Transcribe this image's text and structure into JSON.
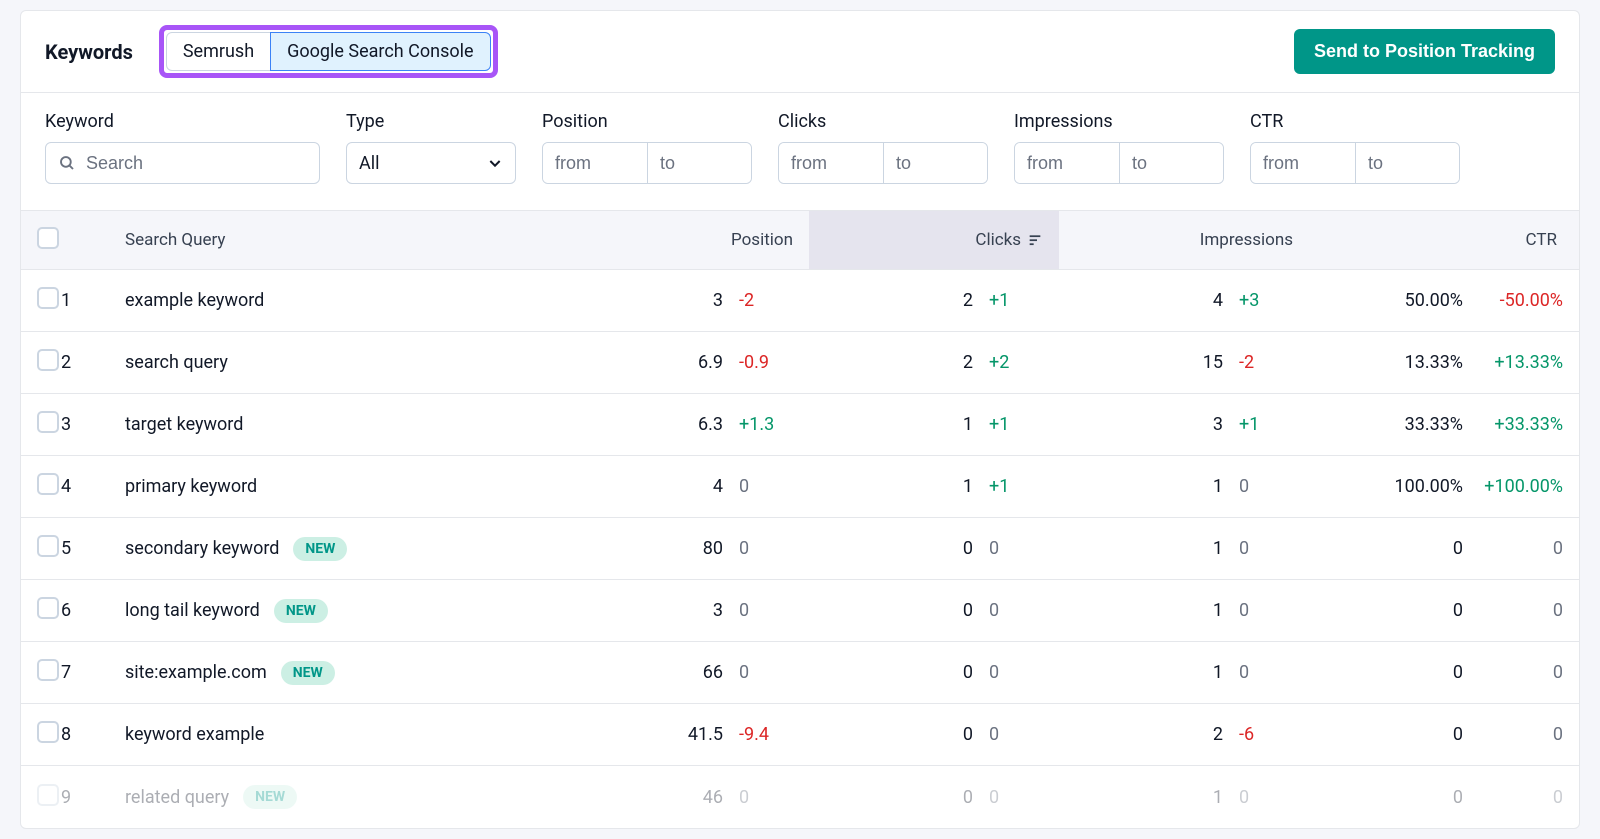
{
  "title": "Keywords",
  "tabs": {
    "semrush": "Semrush",
    "gsc": "Google Search Console",
    "active": "gsc"
  },
  "send_button": "Send to Position Tracking",
  "filters": {
    "keyword": {
      "label": "Keyword",
      "placeholder": "Search"
    },
    "type": {
      "label": "Type",
      "value": "All"
    },
    "position": {
      "label": "Position",
      "from": "from",
      "to": "to"
    },
    "clicks": {
      "label": "Clicks",
      "from": "from",
      "to": "to"
    },
    "impr": {
      "label": "Impressions",
      "from": "from",
      "to": "to"
    },
    "ctr": {
      "label": "CTR",
      "from": "from",
      "to": "to"
    }
  },
  "columns": {
    "query": "Search Query",
    "position": "Position",
    "clicks": "Clicks",
    "impressions": "Impressions",
    "ctr": "CTR"
  },
  "new_badge": "NEW",
  "rows": [
    {
      "i": "1",
      "q": "example keyword",
      "new": false,
      "pos": "3",
      "posd": "-2",
      "posc": "red",
      "clk": "2",
      "clkd": "+1",
      "clkc": "green",
      "imp": "4",
      "impd": "+3",
      "impc": "green",
      "ctr": "50.00%",
      "ctrd": "-50.00%",
      "ctrc": "red"
    },
    {
      "i": "2",
      "q": "search query",
      "new": false,
      "pos": "6.9",
      "posd": "-0.9",
      "posc": "red",
      "clk": "2",
      "clkd": "+2",
      "clkc": "green",
      "imp": "15",
      "impd": "-2",
      "impc": "red",
      "ctr": "13.33%",
      "ctrd": "+13.33%",
      "ctrc": "green"
    },
    {
      "i": "3",
      "q": "target keyword",
      "new": false,
      "pos": "6.3",
      "posd": "+1.3",
      "posc": "green",
      "clk": "1",
      "clkd": "+1",
      "clkc": "green",
      "imp": "3",
      "impd": "+1",
      "impc": "green",
      "ctr": "33.33%",
      "ctrd": "+33.33%",
      "ctrc": "green"
    },
    {
      "i": "4",
      "q": "primary keyword",
      "new": false,
      "pos": "4",
      "posd": "0",
      "posc": "gray",
      "clk": "1",
      "clkd": "+1",
      "clkc": "green",
      "imp": "1",
      "impd": "0",
      "impc": "gray",
      "ctr": "100.00%",
      "ctrd": "+100.00%",
      "ctrc": "green"
    },
    {
      "i": "5",
      "q": "secondary keyword",
      "new": true,
      "pos": "80",
      "posd": "0",
      "posc": "gray",
      "clk": "0",
      "clkd": "0",
      "clkc": "gray",
      "imp": "1",
      "impd": "0",
      "impc": "gray",
      "ctr": "0",
      "ctrd": "0",
      "ctrc": "gray"
    },
    {
      "i": "6",
      "q": "long tail keyword",
      "new": true,
      "pos": "3",
      "posd": "0",
      "posc": "gray",
      "clk": "0",
      "clkd": "0",
      "clkc": "gray",
      "imp": "1",
      "impd": "0",
      "impc": "gray",
      "ctr": "0",
      "ctrd": "0",
      "ctrc": "gray"
    },
    {
      "i": "7",
      "q": "site:example.com",
      "new": true,
      "pos": "66",
      "posd": "0",
      "posc": "gray",
      "clk": "0",
      "clkd": "0",
      "clkc": "gray",
      "imp": "1",
      "impd": "0",
      "impc": "gray",
      "ctr": "0",
      "ctrd": "0",
      "ctrc": "gray"
    },
    {
      "i": "8",
      "q": "keyword example",
      "new": false,
      "pos": "41.5",
      "posd": "-9.4",
      "posc": "red",
      "clk": "0",
      "clkd": "0",
      "clkc": "gray",
      "imp": "2",
      "impd": "-6",
      "impc": "red",
      "ctr": "0",
      "ctrd": "0",
      "ctrc": "gray"
    },
    {
      "i": "9",
      "q": "related query",
      "new": true,
      "pos": "46",
      "posd": "0",
      "posc": "gray",
      "clk": "0",
      "clkd": "0",
      "clkc": "gray",
      "imp": "1",
      "impd": "0",
      "impc": "gray",
      "ctr": "0",
      "ctrd": "0",
      "ctrc": "gray",
      "faded": true
    }
  ]
}
